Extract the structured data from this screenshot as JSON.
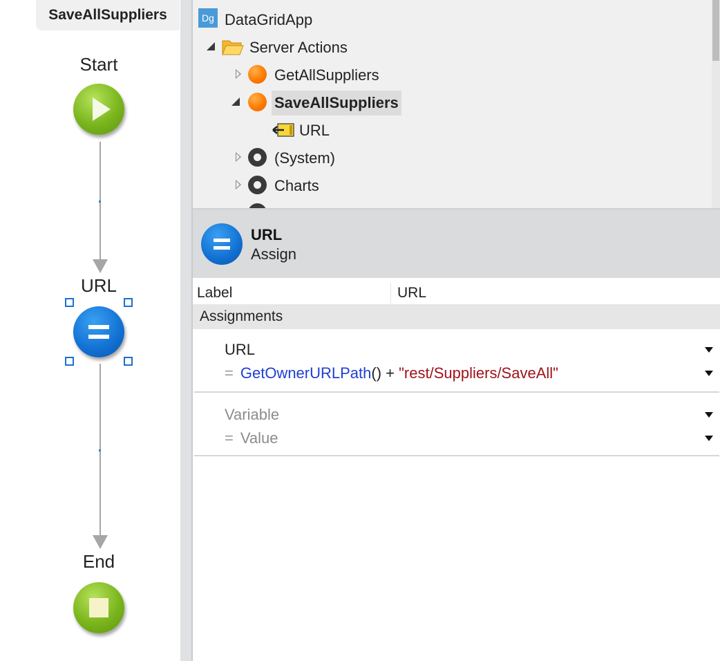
{
  "flow": {
    "tab_title": "SaveAllSuppliers",
    "nodes": {
      "start_label": "Start",
      "assign_label": "URL",
      "end_label": "End"
    }
  },
  "tree": {
    "root": {
      "icon_text": "Dg",
      "label": "DataGridApp"
    },
    "folder_label": "Server Actions",
    "items": [
      {
        "label": "GetAllSuppliers",
        "expanded": false
      },
      {
        "label": "SaveAllSuppliers",
        "expanded": true,
        "selected": true
      },
      {
        "label": "URL"
      },
      {
        "label": "(System)",
        "expanded": false
      },
      {
        "label": "Charts",
        "expanded": false
      }
    ]
  },
  "properties": {
    "title": "URL",
    "subtitle": "Assign",
    "label_key": "Label",
    "label_value": "URL",
    "assignments_header": "Assignments",
    "assignment": {
      "variable": "URL",
      "eq": "=",
      "fn": "GetOwnerURLPath",
      "fn_tail": "() + ",
      "string": "\"rest/Suppliers/SaveAll\""
    },
    "new_assignment": {
      "variable_placeholder": "Variable",
      "eq": "=",
      "value_placeholder": "Value"
    }
  },
  "colors": {
    "accent_blue": "#1170d2",
    "start_end_green": "#7ab51d",
    "action_orange": "#ff7a00",
    "function_blue": "#1f3fd1",
    "string_red": "#a0121b"
  }
}
